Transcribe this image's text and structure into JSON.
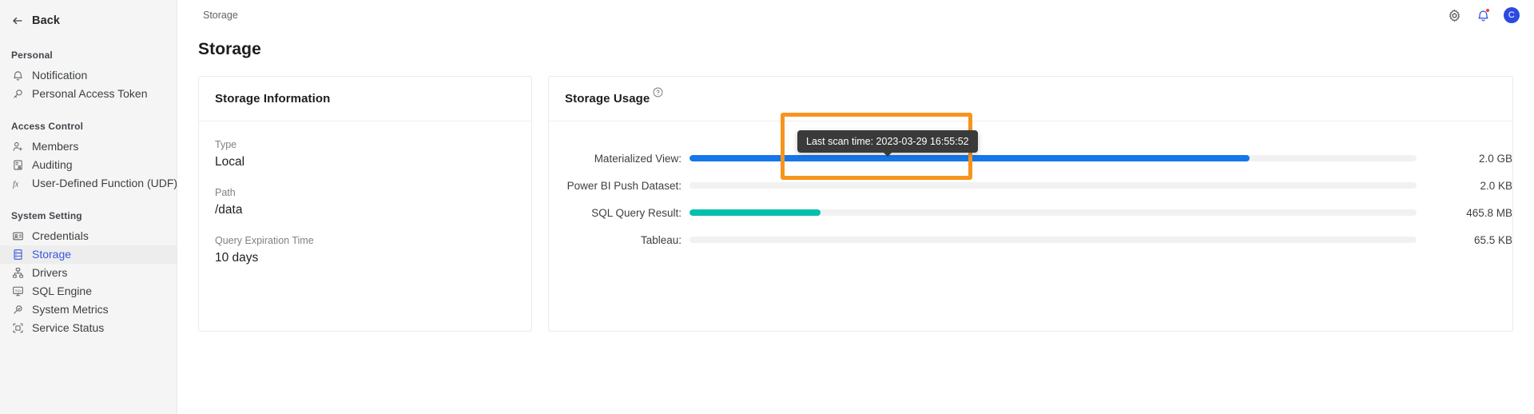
{
  "sidebar": {
    "back": {
      "label": "Back",
      "icon": "arrow-left-icon"
    },
    "groups": [
      {
        "title": "Personal",
        "items": [
          {
            "label": "Notification",
            "icon": "bell-icon",
            "active": false
          },
          {
            "label": "Personal Access Token",
            "icon": "key-icon",
            "active": false
          }
        ]
      },
      {
        "title": "Access Control",
        "items": [
          {
            "label": "Members",
            "icon": "members-icon",
            "active": false
          },
          {
            "label": "Auditing",
            "icon": "auditing-icon",
            "active": false
          },
          {
            "label": "User-Defined Function (UDF)",
            "icon": "fx-icon",
            "active": false
          }
        ]
      },
      {
        "title": "System Setting",
        "items": [
          {
            "label": "Credentials",
            "icon": "credentials-icon",
            "active": false
          },
          {
            "label": "Storage",
            "icon": "storage-icon",
            "active": true
          },
          {
            "label": "Drivers",
            "icon": "drivers-icon",
            "active": false
          },
          {
            "label": "SQL Engine",
            "icon": "sql-engine-icon",
            "active": false
          },
          {
            "label": "System Metrics",
            "icon": "metrics-icon",
            "active": false
          },
          {
            "label": "Service Status",
            "icon": "service-status-icon",
            "active": false
          }
        ]
      }
    ]
  },
  "topbar": {
    "breadcrumb": "Storage",
    "gear_icon": "gear-icon",
    "bell_icon": "bell-icon",
    "avatar_initial": "C"
  },
  "page": {
    "title": "Storage"
  },
  "storage_information": {
    "title": "Storage Information",
    "fields": [
      {
        "label": "Type",
        "value": "Local"
      },
      {
        "label": "Path",
        "value": "/data"
      },
      {
        "label": "Query Expiration Time",
        "value": "10 days"
      }
    ]
  },
  "storage_usage": {
    "title": "Storage Usage",
    "help_icon": "help-circle-icon",
    "tooltip": "Last scan time: 2023-03-29 16:55:52",
    "rows": [
      {
        "label": "Materialized View:",
        "value": "2.0 GB",
        "percent": 77,
        "color": "#1677e8"
      },
      {
        "label": "Power BI Push Dataset:",
        "value": "2.0 KB",
        "percent": 0,
        "color": "#1677e8"
      },
      {
        "label": "SQL Query Result:",
        "value": "465.8 MB",
        "percent": 18,
        "color": "#00bfae"
      },
      {
        "label": "Tableau:",
        "value": "65.5 KB",
        "percent": 0,
        "color": "#1677e8"
      }
    ]
  },
  "colors": {
    "accent_blue": "#3b56e0",
    "bar_blue": "#1677e8",
    "bar_teal": "#00bfae",
    "highlight_orange": "#f7941e",
    "tooltip_bg": "#3a3a3a",
    "badge_red": "#f4412c"
  }
}
